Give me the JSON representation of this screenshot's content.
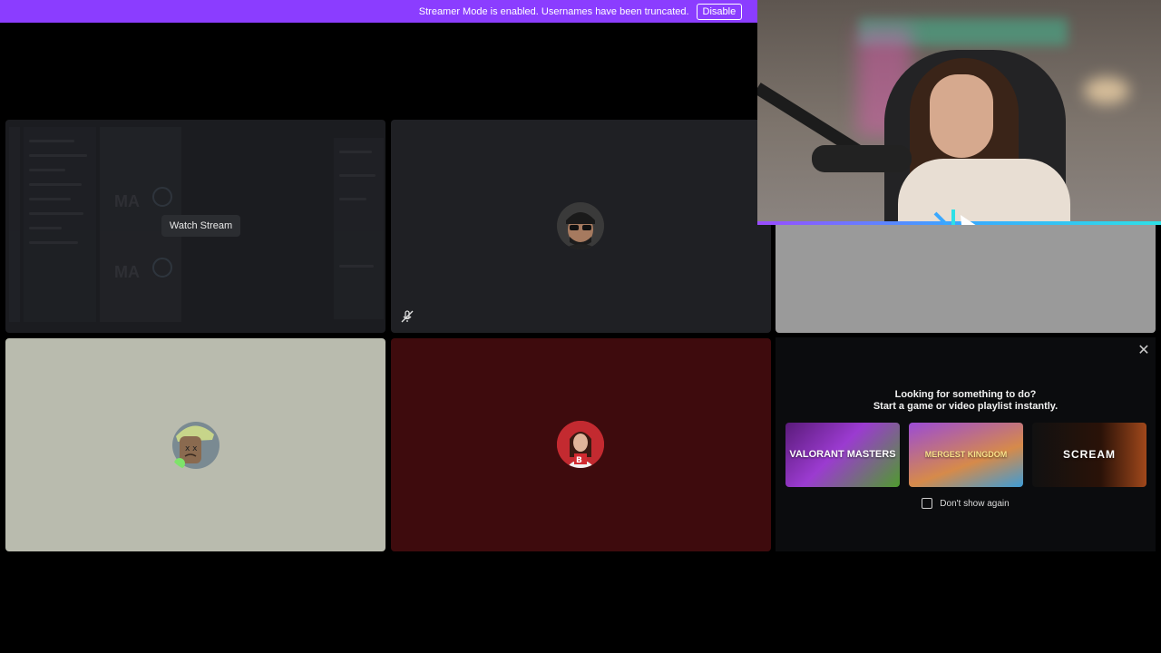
{
  "banner": {
    "message": "Streamer Mode is enabled. Usernames have been truncated.",
    "disable_label": "Disable",
    "color": "#8b3dff"
  },
  "tiles": {
    "stream": {
      "watch_label": "Watch Stream"
    },
    "participant_a": {
      "muted": true,
      "mute_icon": "mic-slash-icon"
    },
    "participant_b": {
      "color": "#9a9a9a"
    },
    "participant_c": {
      "color": "#b9bbae"
    },
    "participant_d": {
      "color": "#3e0b0d"
    }
  },
  "promo": {
    "title": "Looking for something to do?",
    "subtitle": "Start a game or video playlist instantly.",
    "close_icon": "close-icon",
    "activities": [
      {
        "label": "VALORANT MASTERS"
      },
      {
        "label": "MERGEST KINGDOM"
      },
      {
        "label": "SCREAM"
      }
    ],
    "dont_show_label": "Don't show again"
  }
}
